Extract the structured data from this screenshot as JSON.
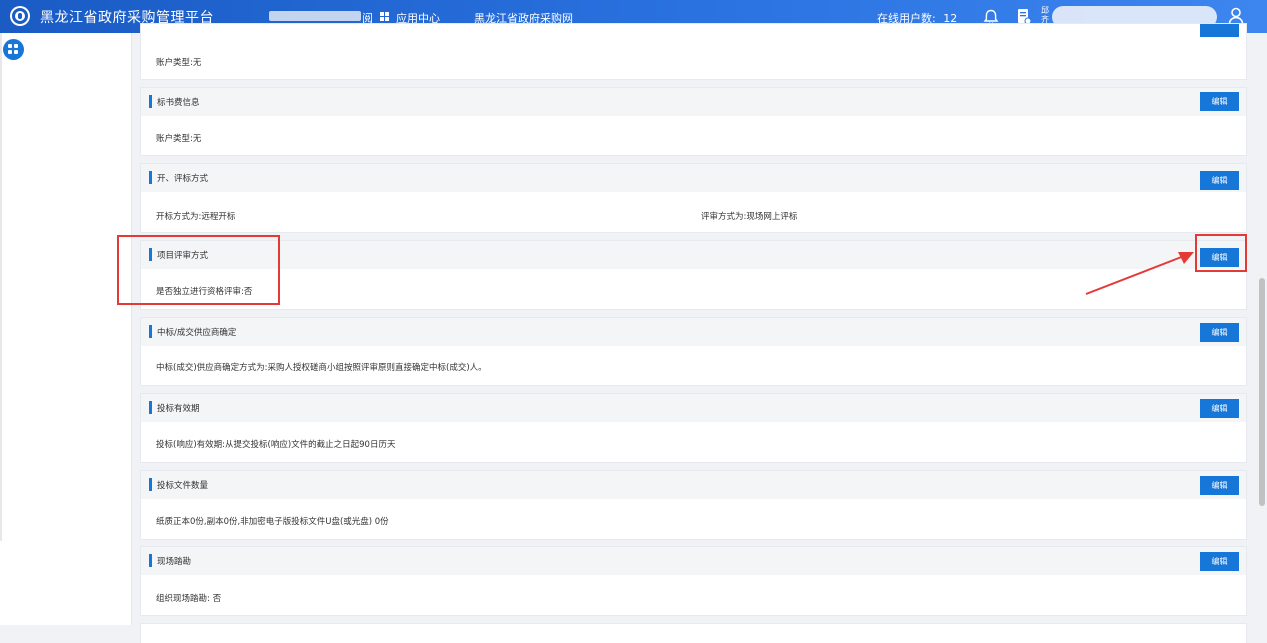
{
  "header": {
    "app_title": "黑龙江省政府采购管理平台",
    "nav_partial": "阅",
    "app_center": "应用中心",
    "procurement_site": "黑龙江省政府采购网",
    "online_label": "在线用户数:",
    "online_count": "12",
    "user_line1": "邱",
    "user_line2": "齐"
  },
  "sections": [
    {
      "title": "",
      "edit_label": "",
      "body": "账户类型:无"
    },
    {
      "title": "标书费信息",
      "edit_label": "编辑",
      "body": "账户类型:无"
    },
    {
      "title": "开、评标方式",
      "edit_label": "编辑",
      "body": "开标方式为:远程开标",
      "body_right": "评审方式为:现场网上评标"
    },
    {
      "title": "项目评审方式",
      "edit_label": "编辑",
      "body": "是否独立进行资格评审:否"
    },
    {
      "title": "中标/成交供应商确定",
      "edit_label": "编辑",
      "body": "中标(成交)供应商确定方式为:采购人授权磋商小组按照评审原则直接确定中标(成交)人。"
    },
    {
      "title": "投标有效期",
      "edit_label": "编辑",
      "body": "投标(响应)有效期:从提交投标(响应)文件的截止之日起90日历天"
    },
    {
      "title": "投标文件数量",
      "edit_label": "编辑",
      "body": "纸质正本0份,副本0份,非加密电子版投标文件U盘(或光盘) 0份"
    },
    {
      "title": "现场踏勘",
      "edit_label": "编辑",
      "body": "组织现场踏勘: 否"
    }
  ],
  "colors": {
    "primary": "#1677d9",
    "annotation": "#e53935"
  },
  "icons": [
    "logo-icon",
    "apps-grid-icon",
    "bell-icon",
    "document-icon",
    "user-icon",
    "menu-grid-icon"
  ]
}
